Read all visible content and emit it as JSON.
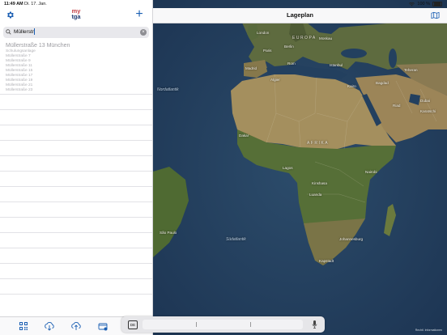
{
  "status": {
    "time": "11:49 AM",
    "date": "Di. 17. Jan.",
    "battery": "100 %"
  },
  "sidebar": {
    "logo_line1": "my",
    "logo_line2": "tga",
    "search": {
      "value": "Müllerstr"
    },
    "result": {
      "title": "Müllerstraße 13 München",
      "items": [
        "Schulungsanlage",
        "Müllerstraße 7",
        "Müllerstraße 9",
        "Müllerstraße 11",
        "Müllerstraße 15",
        "Müllerstraße 17",
        "Müllerstraße 19",
        "Müllerstraße 21",
        "Müllerstraße 23"
      ]
    },
    "tabs": [
      "qr-code-icon",
      "cloud-download-icon",
      "cloud-upload-icon",
      "wallet-icon"
    ]
  },
  "map": {
    "title": "Lageplan",
    "labels": {
      "europa": "EUROPA",
      "afrika": "AFRIKA",
      "nordatlantik": "Nordatlantik",
      "suedatlantik": "Südatlantik",
      "london": "London",
      "berlin": "Berlin",
      "moskau": "Moskau",
      "paris": "Paris",
      "madrid": "Madrid",
      "rom": "Rom",
      "istanbul": "Istanbul",
      "algier": "Algier",
      "kairo": "Kairo",
      "riad": "Riad",
      "dubai": "Dubai",
      "karatschi": "Karatschi",
      "teheran": "Teheran",
      "bagdad": "Bagdad",
      "lagos": "Lagos",
      "kinshasa": "Kinshasa",
      "nairobi": "Nairobi",
      "luanda": "Luanda",
      "sao_paulo": "São Paulo",
      "johannesburg": "Johannesburg",
      "kapstadt": "Kapstadt",
      "dakar": "Dakar"
    },
    "attribution": "Rechtl. Informationen"
  },
  "keyboard": {
    "lang": "DE"
  }
}
